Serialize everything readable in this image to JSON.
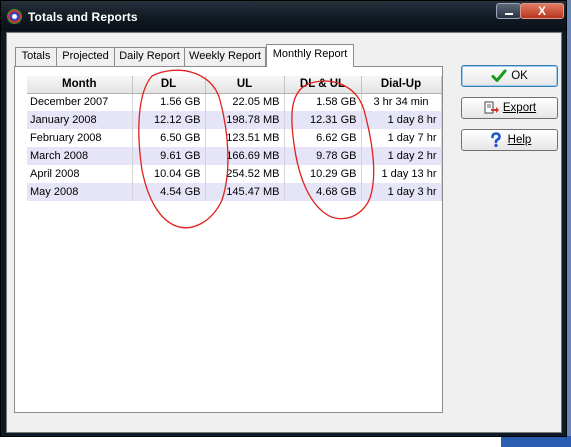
{
  "window": {
    "title": "Totals and Reports",
    "close_glyph": "X"
  },
  "tabs": [
    {
      "label": "Totals"
    },
    {
      "label": "Projected"
    },
    {
      "label": "Daily Report"
    },
    {
      "label": "Weekly Report"
    },
    {
      "label": "Monthly Report",
      "active": true
    }
  ],
  "table": {
    "columns": [
      "Month",
      "DL",
      "UL",
      "DL & UL",
      "Dial-Up"
    ],
    "rows": [
      [
        "December 2007",
        "1.56 GB",
        "22.05 MB",
        "1.58 GB",
        "3 hr 34 min"
      ],
      [
        "January 2008",
        "12.12 GB",
        "198.78 MB",
        "12.31 GB",
        "1 day 8 hr"
      ],
      [
        "February 2008",
        "6.50 GB",
        "123.51 MB",
        "6.62 GB",
        "1 day 7 hr"
      ],
      [
        "March 2008",
        "9.61 GB",
        "166.69 MB",
        "9.78 GB",
        "1 day 2 hr"
      ],
      [
        "April 2008",
        "10.04 GB",
        "254.52 MB",
        "10.29 GB",
        "1 day 13 hr"
      ],
      [
        "May 2008",
        "4.54 GB",
        "145.47 MB",
        "4.68 GB",
        "1 day 3 hr"
      ]
    ]
  },
  "buttons": {
    "ok": {
      "label": "OK",
      "icon": "checkmark-icon"
    },
    "export": {
      "label": "Export",
      "icon": "export-icon"
    },
    "help": {
      "label": "Help",
      "icon": "question-icon"
    }
  },
  "annotation_color": "#e0201a"
}
